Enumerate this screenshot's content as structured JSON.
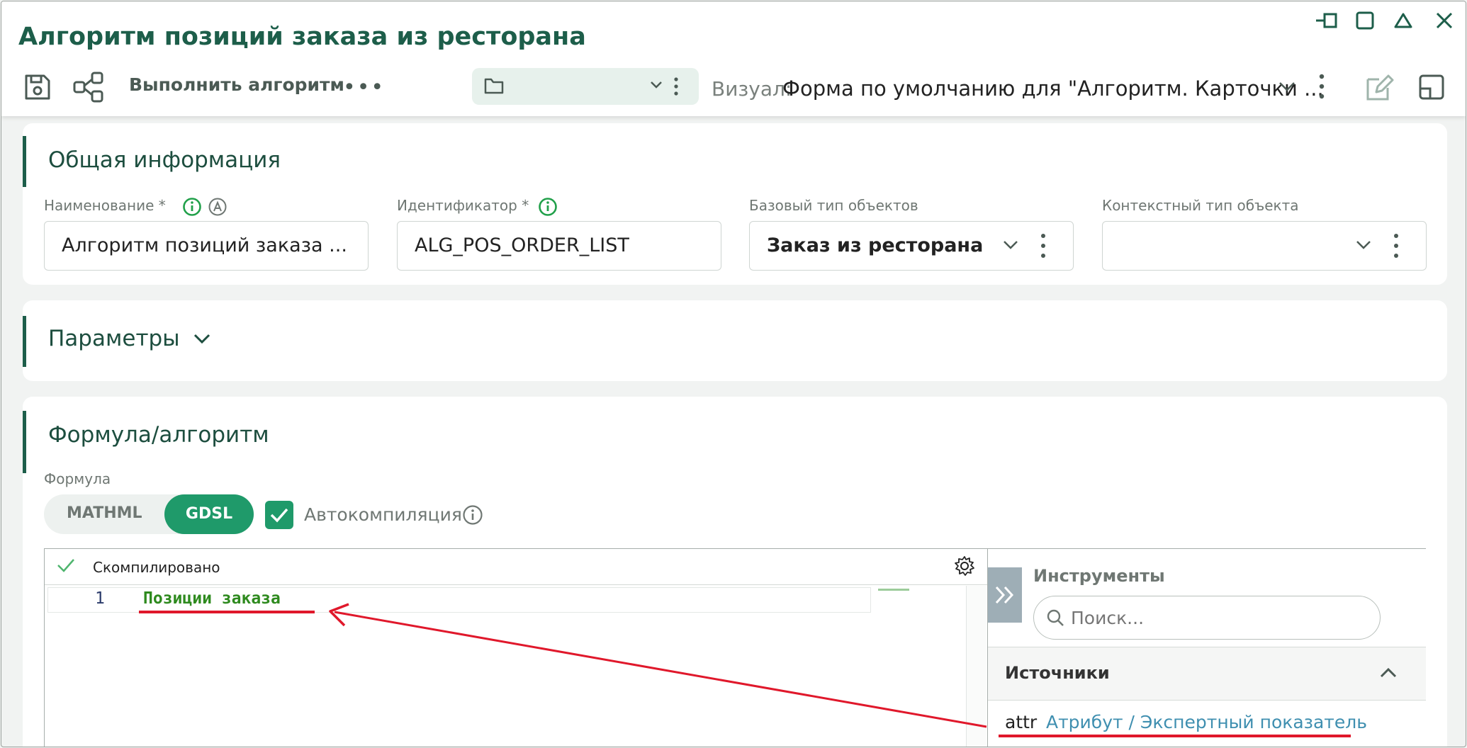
{
  "window": {
    "title": "Алгоритм позиций заказа из ресторана",
    "controls": [
      "pin-icon",
      "maximize-icon",
      "collapse-icon",
      "close-icon"
    ]
  },
  "toolbar": {
    "save_icon": "save-icon",
    "graph_icon": "share-graph-icon",
    "run_label": "Выполнить алгоритм",
    "more_label": "•••",
    "folder_value": "",
    "visual_label": "Визуал:",
    "visual_value": "Форма по умолчанию для \"Алгоритм. Карточки ...",
    "edit_icon": "edit-icon",
    "layout_icon": "layout-icon"
  },
  "general": {
    "title": "Общая информация",
    "fields": [
      {
        "label": "Наименование *",
        "value": "Алгоритм позиций заказа ..."
      },
      {
        "label": "Идентификатор *",
        "value": "ALG_POS_ORDER_LIST"
      },
      {
        "label": "Базовый тип объектов",
        "value": "Заказ из ресторана"
      },
      {
        "label": "Контекстный тип объекта",
        "value": ""
      }
    ]
  },
  "params": {
    "title": "Параметры"
  },
  "formula": {
    "title": "Формула/алгоритм",
    "label": "Формула",
    "modes": [
      "MATHML",
      "GDSL"
    ],
    "selected_mode": "GDSL",
    "autocompile_label": "Автокомпиляция",
    "autocompile_checked": true,
    "status": "Скомпилировано",
    "code_lines": [
      {
        "num": "1",
        "text": "Позиции заказа"
      }
    ],
    "tools_title": "Инструменты",
    "search_placeholder": "Поиск...",
    "sources_title": "Источники",
    "source_item": {
      "code": "attr",
      "text": "Атрибут / Экспертный показатель"
    }
  },
  "colors": {
    "accent": "#1d5e4a",
    "toggle_active": "#1f9a6a",
    "annotation": "#e0182b",
    "code_green": "#2e8a1e"
  }
}
